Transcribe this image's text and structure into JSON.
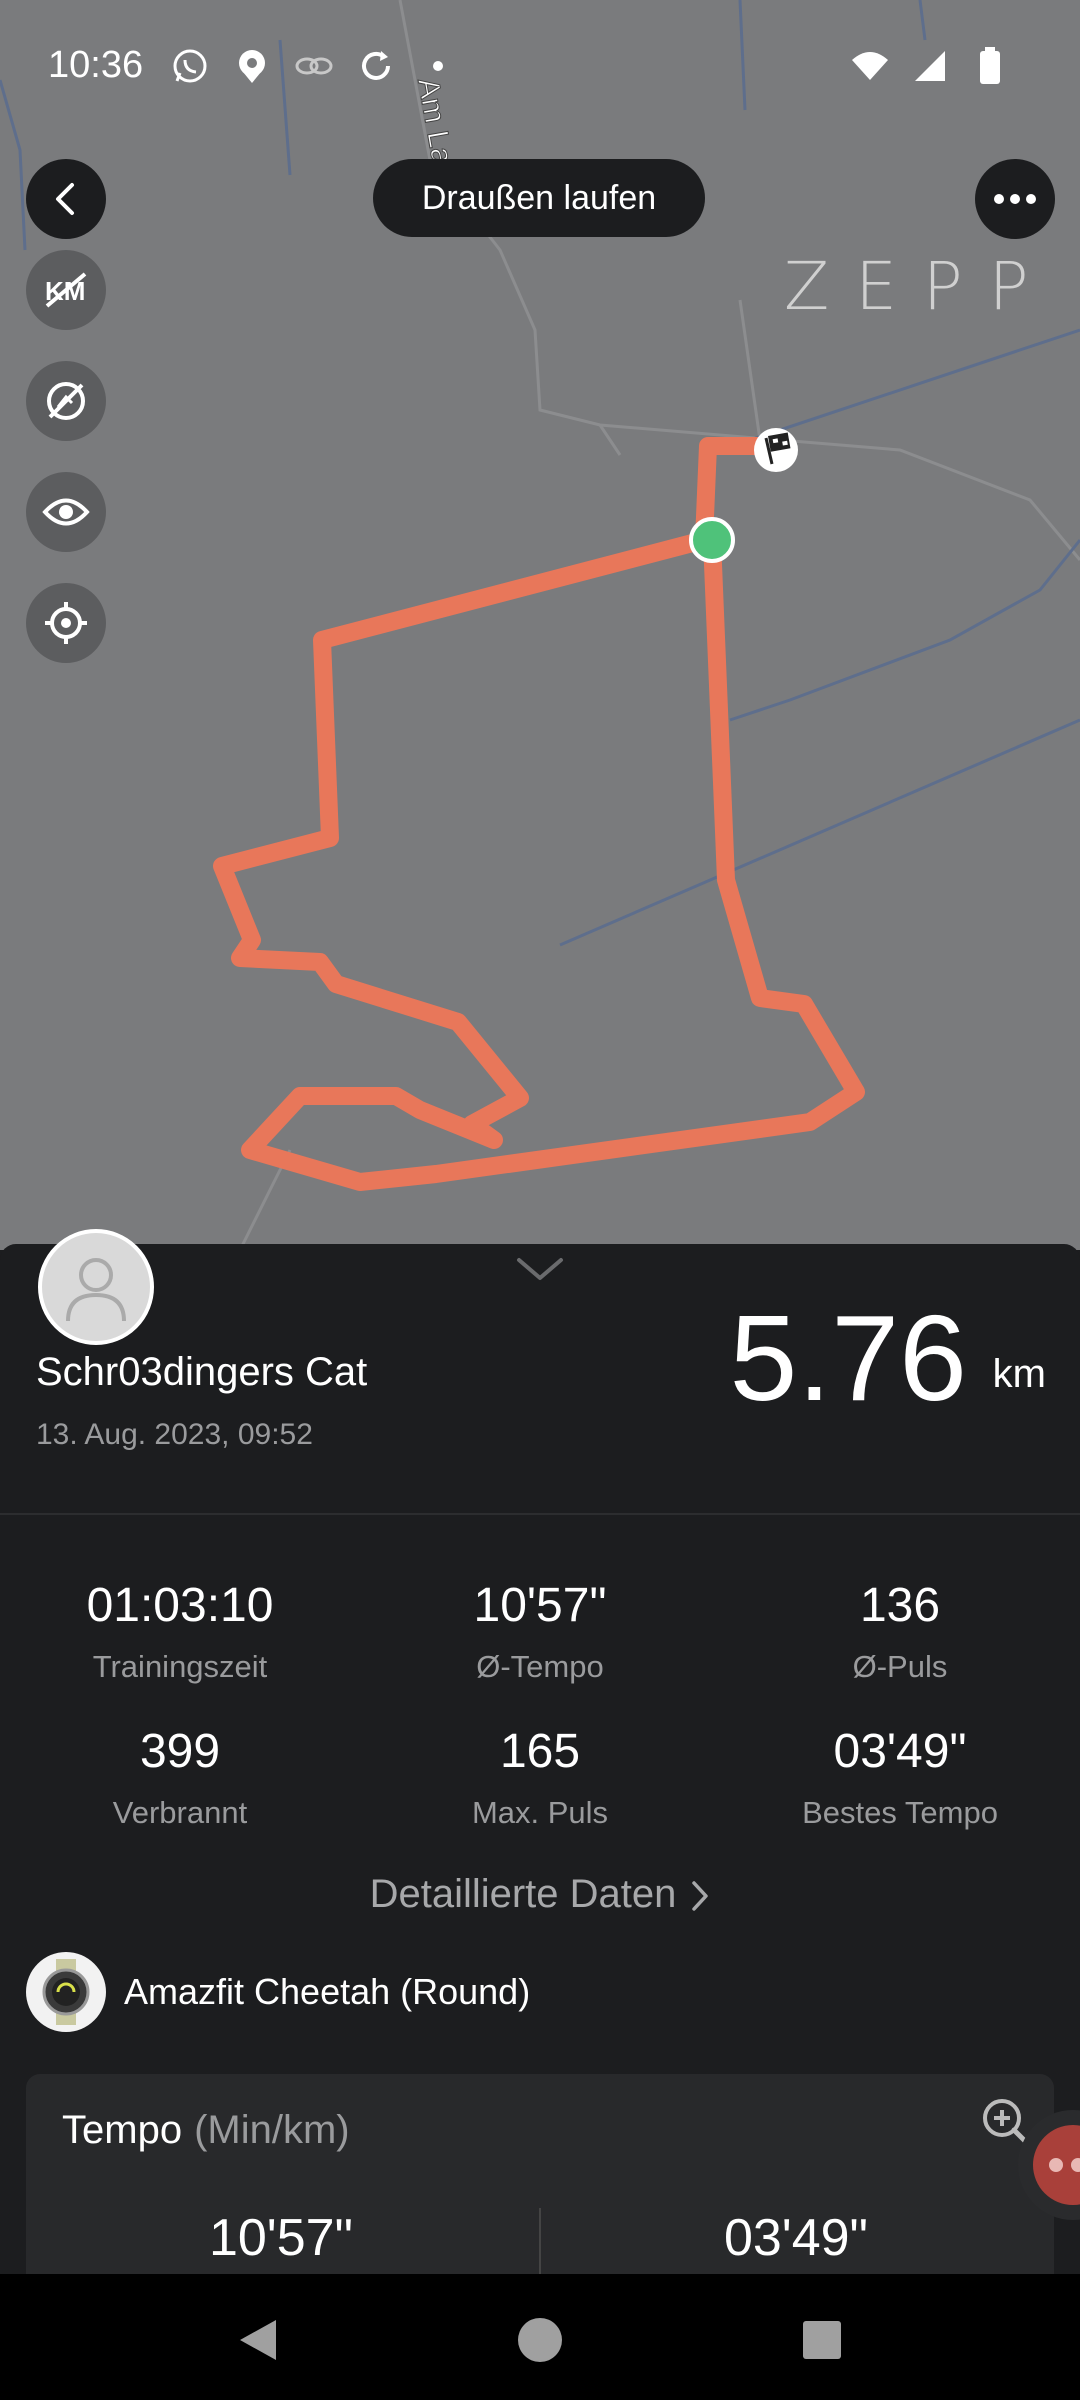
{
  "status_bar": {
    "time": "10:36",
    "left_icons": [
      "whatsapp-icon",
      "location-pin-icon",
      "link-icon",
      "sync-icon",
      "dot-icon"
    ],
    "right_icons": [
      "wifi-icon",
      "signal-icon",
      "battery-icon"
    ]
  },
  "map": {
    "street_label": "Am La",
    "activity_type": "Draußen laufen",
    "brand_logo": "ZEPP",
    "side_buttons": [
      "km-marker-icon",
      "hide-speed-icon",
      "eye-icon",
      "locate-icon"
    ],
    "route_color": "#e8775a",
    "start_marker_color": "#4fc27a"
  },
  "summary": {
    "user_name": "Schr03dingers Cat",
    "date": "13. Aug. 2023, 09:52",
    "distance_value": "5.76",
    "distance_unit": "km"
  },
  "stats": [
    {
      "value": "01:03:10",
      "label": "Trainingszeit"
    },
    {
      "value": "10'57\"",
      "label": "Ø-Tempo"
    },
    {
      "value": "136",
      "label": "Ø-Puls"
    },
    {
      "value": "399",
      "label": "Verbrannt"
    },
    {
      "value": "165",
      "label": "Max. Puls"
    },
    {
      "value": "03'49\"",
      "label": "Bestes Tempo"
    }
  ],
  "details_link": "Detaillierte Daten",
  "device": {
    "name": "Amazfit Cheetah (Round)"
  },
  "tempo_card": {
    "title": "Tempo",
    "unit": "(Min/km)",
    "avg": "10'57\"",
    "best": "03'49\""
  },
  "colors": {
    "map_bg": "#7a7b7d",
    "sheet_bg": "#1c1d1f",
    "accent": "#e8775a"
  }
}
